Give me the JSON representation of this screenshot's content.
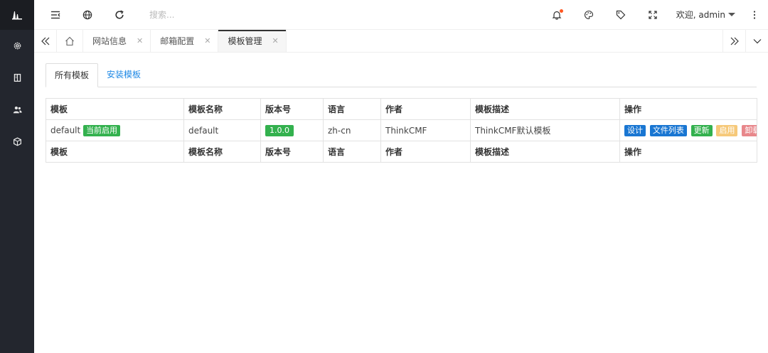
{
  "topbar": {
    "search_placeholder": "搜索...",
    "user_label": "欢迎, admin"
  },
  "tabs": [
    {
      "label": "网站信息",
      "active": false
    },
    {
      "label": "邮箱配置",
      "active": false
    },
    {
      "label": "模板管理",
      "active": true
    }
  ],
  "content_tabs": {
    "all": "所有模板",
    "install": "安装模板"
  },
  "table": {
    "columns": [
      "模板",
      "模板名称",
      "版本号",
      "语言",
      "作者",
      "模板描述",
      "操作"
    ],
    "row": {
      "template": "default",
      "current_badge": "当前启用",
      "name": "default",
      "version": "1.0.0",
      "lang": "zh-cn",
      "author": "ThinkCMF",
      "description": "ThinkCMF默认模板",
      "actions": {
        "design": "设计",
        "files": "文件列表",
        "update": "更新",
        "enable": "启用",
        "uninstall": "卸载"
      }
    }
  },
  "colors": {
    "sidebar_bg": "#23262e",
    "accent_blue": "#1976d2",
    "accent_green": "#33b14e",
    "accent_orange": "#f6c97a",
    "accent_red": "#e8878b",
    "notify_dot": "#ff5722"
  },
  "icons": {
    "sidebar": [
      "logo-icon",
      "gear-icon",
      "book-icon",
      "users-icon",
      "cube-icon"
    ],
    "topbar": [
      "menu-indent-icon",
      "globe-icon",
      "refresh-icon",
      "bell-icon",
      "palette-icon",
      "tag-icon",
      "fullscreen-icon",
      "more-vertical-icon"
    ]
  }
}
